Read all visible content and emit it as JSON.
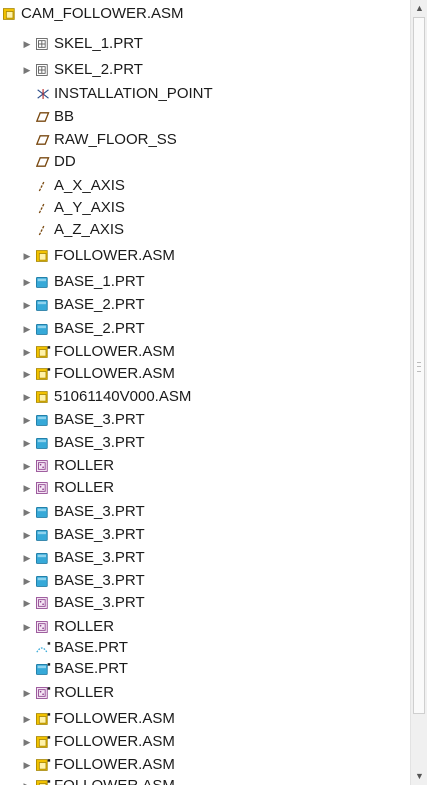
{
  "tree": {
    "items": [
      {
        "label": "CAM_FOLLOWER.ASM",
        "icon": "assembly-icon",
        "expand": "none",
        "indent": 0
      },
      {
        "label": "SKEL_1.PRT",
        "icon": "skeleton-icon",
        "expand": "collapsed"
      },
      {
        "label": "SKEL_2.PRT",
        "icon": "skeleton-icon",
        "expand": "collapsed"
      },
      {
        "label": "INSTALLATION_POINT",
        "icon": "coordinate-system-icon",
        "expand": "none"
      },
      {
        "label": "BB",
        "icon": "datum-plane-icon",
        "expand": "none"
      },
      {
        "label": "RAW_FLOOR_SS",
        "icon": "datum-plane-icon",
        "expand": "none"
      },
      {
        "label": "DD",
        "icon": "datum-plane-icon",
        "expand": "none"
      },
      {
        "label": "A_X_AXIS",
        "icon": "datum-axis-icon",
        "expand": "none"
      },
      {
        "label": "A_Y_AXIS",
        "icon": "datum-axis-icon",
        "expand": "none"
      },
      {
        "label": "A_Z_AXIS",
        "icon": "datum-axis-icon",
        "expand": "none"
      },
      {
        "label": "FOLLOWER.ASM",
        "icon": "assembly-icon",
        "expand": "collapsed"
      },
      {
        "label": "BASE_1.PRT",
        "icon": "part-icon",
        "expand": "collapsed"
      },
      {
        "label": "BASE_2.PRT",
        "icon": "part-icon",
        "expand": "collapsed"
      },
      {
        "label": "BASE_2.PRT",
        "icon": "part-icon",
        "expand": "collapsed"
      },
      {
        "label": "FOLLOWER.ASM",
        "icon": "assembly-flag-icon",
        "expand": "collapsed"
      },
      {
        "label": "FOLLOWER.ASM",
        "icon": "assembly-flag-icon",
        "expand": "collapsed"
      },
      {
        "label": "51061140V000.ASM",
        "icon": "assembly-icon",
        "expand": "collapsed"
      },
      {
        "label": "BASE_3.PRT",
        "icon": "part-icon",
        "expand": "collapsed"
      },
      {
        "label": "BASE_3.PRT",
        "icon": "part-icon",
        "expand": "collapsed"
      },
      {
        "label": "ROLLER",
        "icon": "roller-part-icon",
        "expand": "collapsed"
      },
      {
        "label": "ROLLER",
        "icon": "roller-part-icon",
        "expand": "collapsed"
      },
      {
        "label": "BASE_3.PRT",
        "icon": "part-icon",
        "expand": "collapsed"
      },
      {
        "label": "BASE_3.PRT",
        "icon": "part-icon",
        "expand": "collapsed"
      },
      {
        "label": "BASE_3.PRT",
        "icon": "part-icon",
        "expand": "collapsed"
      },
      {
        "label": "BASE_3.PRT",
        "icon": "part-icon",
        "expand": "collapsed"
      },
      {
        "label": "BASE_3.PRT",
        "icon": "roller-part-icon",
        "expand": "collapsed"
      },
      {
        "label": "ROLLER",
        "icon": "roller-part-icon",
        "expand": "collapsed"
      },
      {
        "label": "BASE.PRT",
        "icon": "part-dashed-flag-icon",
        "expand": "none"
      },
      {
        "label": "BASE.PRT",
        "icon": "part-flag-icon",
        "expand": "none"
      },
      {
        "label": "ROLLER",
        "icon": "roller-flag-icon",
        "expand": "collapsed"
      },
      {
        "label": "FOLLOWER.ASM",
        "icon": "assembly-flag-icon",
        "expand": "collapsed"
      },
      {
        "label": "FOLLOWER.ASM",
        "icon": "assembly-flag-icon",
        "expand": "collapsed"
      },
      {
        "label": "FOLLOWER.ASM",
        "icon": "assembly-flag-icon",
        "expand": "collapsed"
      },
      {
        "label": "FOLLOWER.ASM",
        "icon": "assembly-flag-icon",
        "expand": "collapsed"
      }
    ]
  },
  "scrollbar": {
    "up_glyph": "▲",
    "down_glyph": "▼"
  },
  "colors": {
    "assembly": "#f2c200",
    "part": "#36a9d8",
    "roller": "#8c3f8c",
    "datum": "#7a4a12",
    "csys": "#2b4d8a"
  }
}
